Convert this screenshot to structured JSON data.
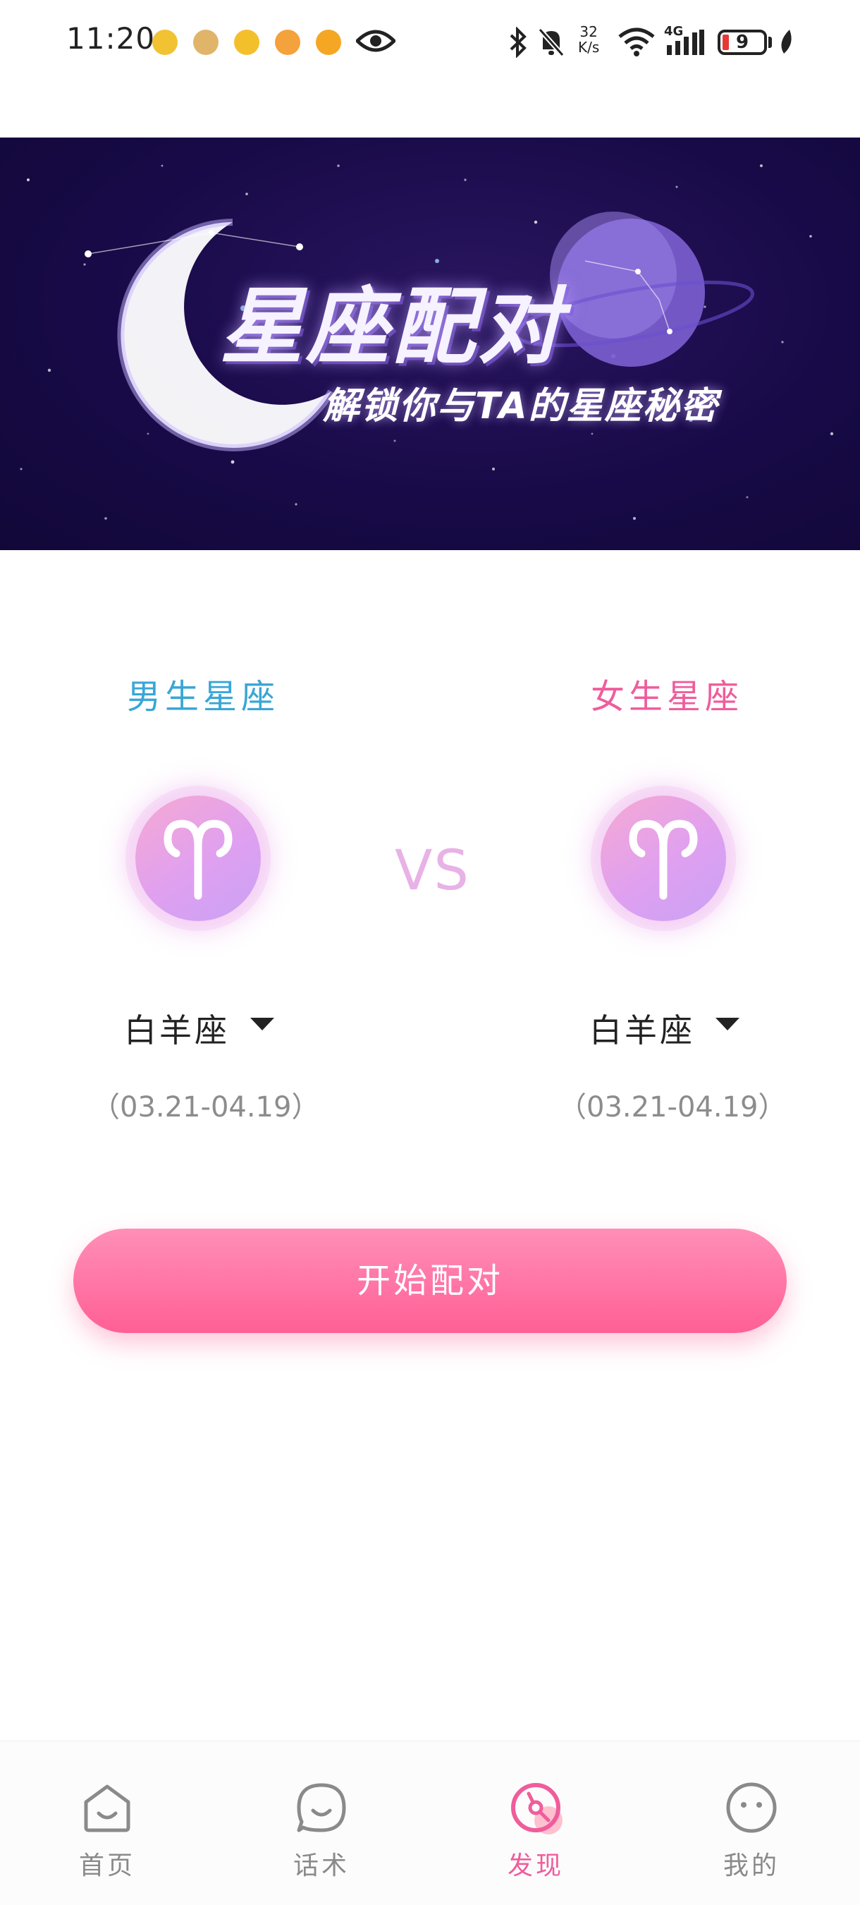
{
  "status_bar": {
    "time": "11:20",
    "net_speed_value": "32",
    "net_speed_unit": "K/s",
    "network_type": "4G",
    "battery": "9"
  },
  "banner": {
    "title": "星座配对",
    "subtitle": "解锁你与TA的星座秘密"
  },
  "match": {
    "male": {
      "label": "男生星座",
      "sign_name": "白羊座",
      "date_range": "（03.21-04.19）",
      "icon": "aries-icon"
    },
    "female": {
      "label": "女生星座",
      "sign_name": "白羊座",
      "date_range": "（03.21-04.19）",
      "icon": "aries-icon"
    },
    "vs": "VS",
    "start_button": "开始配对"
  },
  "bottom_nav": {
    "items": [
      {
        "label": "首页",
        "icon": "home-icon",
        "active": false
      },
      {
        "label": "话术",
        "icon": "chat-icon",
        "active": false
      },
      {
        "label": "发现",
        "icon": "discover-icon",
        "active": true
      },
      {
        "label": "我的",
        "icon": "profile-icon",
        "active": false
      }
    ]
  },
  "colors": {
    "male_accent": "#3aa6d6",
    "female_accent": "#ef5d9c",
    "button_gradient": [
      "#ff8fb8",
      "#ff5f95"
    ],
    "banner_bg": "#180a48"
  }
}
